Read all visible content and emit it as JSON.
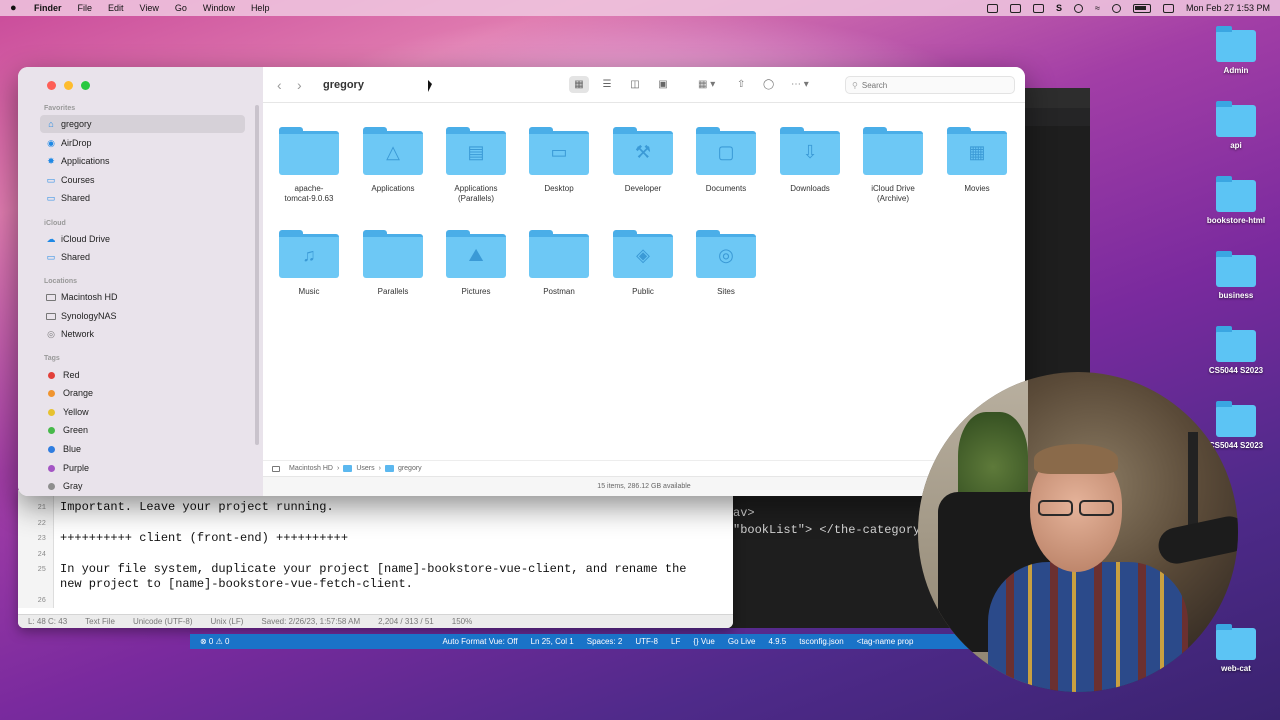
{
  "menubar": {
    "app": "Finder",
    "items": [
      "File",
      "Edit",
      "View",
      "Go",
      "Window",
      "Help"
    ],
    "clock": "Mon Feb 27  1:53 PM"
  },
  "desktop": {
    "icons": [
      "Admin",
      "api",
      "bookstore-html",
      "business",
      "CS5044 S2023",
      "CS5044 S2023",
      "web-cat"
    ]
  },
  "finder": {
    "title": "gregory",
    "search_placeholder": "Search",
    "sidebar": {
      "favorites_header": "Favorites",
      "favorites": [
        "gregory",
        "AirDrop",
        "Applications",
        "Courses",
        "Shared"
      ],
      "icloud_header": "iCloud",
      "icloud": [
        "iCloud Drive",
        "Shared"
      ],
      "locations_header": "Locations",
      "locations": [
        "Macintosh HD",
        "SynologyNAS",
        "Network"
      ],
      "tags_header": "Tags",
      "tags": [
        {
          "name": "Red",
          "color": "#e2403a"
        },
        {
          "name": "Orange",
          "color": "#f0942f"
        },
        {
          "name": "Yellow",
          "color": "#e7c230"
        },
        {
          "name": "Green",
          "color": "#47b94a"
        },
        {
          "name": "Blue",
          "color": "#2f7de0"
        },
        {
          "name": "Purple",
          "color": "#a455c4"
        },
        {
          "name": "Gray",
          "color": "#8e8e8e"
        }
      ]
    },
    "items": [
      {
        "line1": "apache-",
        "line2": "tomcat-9.0.63",
        "icon": "folder"
      },
      {
        "line1": "Applications",
        "line2": "",
        "icon": "applications-glyph"
      },
      {
        "line1": "Applications",
        "line2": "(Parallels)",
        "icon": "parallels-glyph"
      },
      {
        "line1": "Desktop",
        "line2": "",
        "icon": "desktop-glyph"
      },
      {
        "line1": "Developer",
        "line2": "",
        "icon": "hammer-glyph"
      },
      {
        "line1": "Documents",
        "line2": "",
        "icon": "document-glyph"
      },
      {
        "line1": "Downloads",
        "line2": "",
        "icon": "download-glyph"
      },
      {
        "line1": "iCloud Drive",
        "line2": "(Archive)",
        "icon": "folder"
      },
      {
        "line1": "Movies",
        "line2": "",
        "icon": "film-glyph"
      },
      {
        "line1": "Music",
        "line2": "",
        "icon": "music-glyph"
      },
      {
        "line1": "Parallels",
        "line2": "",
        "icon": "folder"
      },
      {
        "line1": "Pictures",
        "line2": "",
        "icon": "picture-glyph"
      },
      {
        "line1": "Postman",
        "line2": "",
        "icon": "folder"
      },
      {
        "line1": "Public",
        "line2": "",
        "icon": "public-glyph"
      },
      {
        "line1": "Sites",
        "line2": "",
        "icon": "compass-glyph"
      }
    ],
    "path": [
      "Macintosh HD",
      "Users",
      "gregory"
    ],
    "status": "15 items, 286.12 GB available"
  },
  "editor": {
    "lines": [
      {
        "n": "21",
        "text": "Important. Leave your project running."
      },
      {
        "n": "22",
        "text": ""
      },
      {
        "n": "23",
        "text": "++++++++++ client (front-end) ++++++++++"
      },
      {
        "n": "24",
        "text": ""
      },
      {
        "n": "25",
        "text": "In your file system, duplicate your project [name]-bookstore-vue-client, and rename the"
      },
      {
        "n": "",
        "text": "new project to [name]-bookstore-vue-fetch-client."
      },
      {
        "n": "26",
        "text": ""
      }
    ],
    "status": [
      "L: 48 C: 43",
      "Text File",
      "Unicode (UTF-8)",
      "Unix (LF)",
      "Saved: 2/26/23, 1:57:58 AM",
      "2,204 / 313 / 51",
      "150%"
    ]
  },
  "vscode": {
    "code1": "av>",
    "code2": "\"bookList\"> </the-category",
    "statusbar": [
      "⊗ 0 ⚠ 0",
      "Auto Format Vue: Off",
      "Ln 25, Col 1",
      "Spaces: 2",
      "UTF-8",
      "LF",
      "{} Vue",
      "Go Live",
      "4.9.5",
      "tsconfig.json",
      "<tag-name prop"
    ]
  },
  "colors": {
    "accent": "#1e88e5",
    "folder": "#6dc8f5",
    "vscode_status": "#1a73c8"
  }
}
